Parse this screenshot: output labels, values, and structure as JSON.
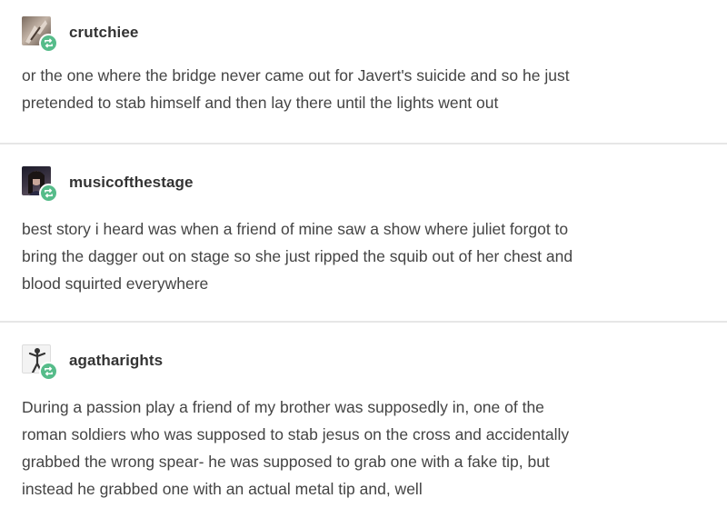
{
  "posts": [
    {
      "username": "crutchiee",
      "avatar_icon": "user-avatar-icon",
      "badge_icon": "reblog-icon",
      "lines": [
        "or the one where the bridge never came out for Javert's suicide and so he just",
        "pretended to stab himself and then lay there until the lights went out"
      ]
    },
    {
      "username": "musicofthestage",
      "avatar_icon": "user-avatar-icon",
      "badge_icon": "reblog-icon",
      "lines": [
        "best story i heard was when a friend of mine saw a show where juliet forgot to",
        "bring the dagger out on stage so she just ripped the squib out of her chest and",
        "blood squirted everywhere"
      ]
    },
    {
      "username": "agatharights",
      "avatar_icon": "user-avatar-icon",
      "badge_icon": "reblog-icon",
      "lines": [
        "During a passion play a friend of my brother was supposedly in, one of the",
        "roman soldiers who was supposed to stab jesus on the cross and accidentally",
        "grabbed the wrong spear- he was supposed to grab one with a fake tip, but",
        "instead he grabbed one with an actual metal tip and, well"
      ]
    }
  ],
  "colors": {
    "badge": "#56bc8a",
    "text": "#444444",
    "divider": "#e6e6e6"
  }
}
